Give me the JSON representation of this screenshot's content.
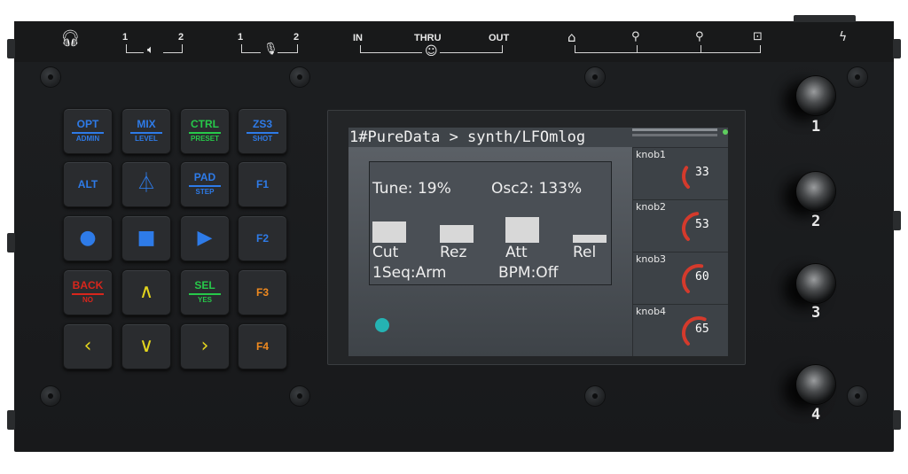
{
  "top_panel": {
    "headphone_icon": "headphone-icon",
    "speaker": {
      "left": "1",
      "right": "2"
    },
    "mic": {
      "left": "1",
      "right": "2"
    },
    "midi": {
      "in": "IN",
      "thru": "THRU",
      "out": "OUT"
    }
  },
  "keys": [
    {
      "name": "opt-admin-key",
      "top": "OPT",
      "sub": "ADMIN",
      "top_color": "#2e7be8",
      "sub_color": "#2e7be8"
    },
    {
      "name": "mix-level-key",
      "top": "MIX",
      "sub": "LEVEL",
      "top_color": "#2e7be8",
      "sub_color": "#2e7be8"
    },
    {
      "name": "ctrl-preset-key",
      "top": "CTRL",
      "sub": "PRESET",
      "top_color": "#27c94a",
      "sub_color": "#27c94a"
    },
    {
      "name": "zs3-shot-key",
      "top": "ZS3",
      "sub": "SHOT",
      "top_color": "#2e7be8",
      "sub_color": "#2e7be8"
    },
    {
      "name": "alt-key",
      "top": "ALT",
      "sub": "",
      "top_color": "#2e7be8"
    },
    {
      "name": "metronome-key",
      "icon": "metronome-icon",
      "glyph": "⏃",
      "top_color": "#2e7be8"
    },
    {
      "name": "pad-step-key",
      "top": "PAD",
      "sub": "STEP",
      "top_color": "#2e7be8",
      "sub_color": "#2e7be8"
    },
    {
      "name": "f1-key",
      "top": "F1",
      "sub": "",
      "top_color": "#2e7be8"
    },
    {
      "name": "record-key",
      "icon": "record-icon",
      "glyph": "●",
      "top_color": "#2e7be8"
    },
    {
      "name": "stop-key",
      "icon": "stop-icon",
      "glyph": "■",
      "top_color": "#2e7be8"
    },
    {
      "name": "play-key",
      "icon": "play-icon",
      "glyph": "▶",
      "top_color": "#2e7be8"
    },
    {
      "name": "f2-key",
      "top": "F2",
      "sub": "",
      "top_color": "#2e7be8"
    },
    {
      "name": "back-no-key",
      "top": "BACK",
      "sub": "NO",
      "top_color": "#d9261c",
      "sub_color": "#d9261c"
    },
    {
      "name": "up-key",
      "icon": "chevron-up-icon",
      "glyph": "∧",
      "top_color": "#e3d51e"
    },
    {
      "name": "sel-yes-key",
      "top": "SEL",
      "sub": "YES",
      "top_color": "#27c94a",
      "sub_color": "#27c94a"
    },
    {
      "name": "f3-key",
      "top": "F3",
      "sub": "",
      "top_color": "#f08a1f"
    },
    {
      "name": "left-key",
      "icon": "chevron-left-icon",
      "glyph": "‹",
      "top_color": "#e3d51e"
    },
    {
      "name": "down-key",
      "icon": "chevron-down-icon",
      "glyph": "∨",
      "top_color": "#e3d51e"
    },
    {
      "name": "right-key",
      "icon": "chevron-right-icon",
      "glyph": "›",
      "top_color": "#e3d51e"
    },
    {
      "name": "f4-key",
      "top": "F4",
      "sub": "",
      "top_color": "#f08a1f"
    }
  ],
  "screen": {
    "title": "1#PureData > synth/LFOmlog",
    "tune": "Tune: 19%",
    "osc2": "Osc2: 133%",
    "params": [
      {
        "label": "Cut",
        "level": 0.55
      },
      {
        "label": "Rez",
        "level": 0.45
      },
      {
        "label": "Att",
        "level": 0.65
      },
      {
        "label": "Rel",
        "level": 0.2
      }
    ],
    "seq": "1Seq:Arm",
    "bpm": "BPM:Off",
    "status_dot_color": "#25b3b3"
  },
  "knob_slots": [
    {
      "name": "knob1",
      "value": "33",
      "level": 0.33
    },
    {
      "name": "knob2",
      "value": "53",
      "level": 0.53
    },
    {
      "name": "knob3",
      "value": "60",
      "level": 0.6
    },
    {
      "name": "knob4",
      "value": "65",
      "level": 0.65
    }
  ],
  "hw_knobs": [
    {
      "label": "1"
    },
    {
      "label": "2"
    },
    {
      "label": "3"
    },
    {
      "label": "4"
    }
  ],
  "colors": {
    "arc": "#d43a2c",
    "chassis": "#1c1e20"
  }
}
